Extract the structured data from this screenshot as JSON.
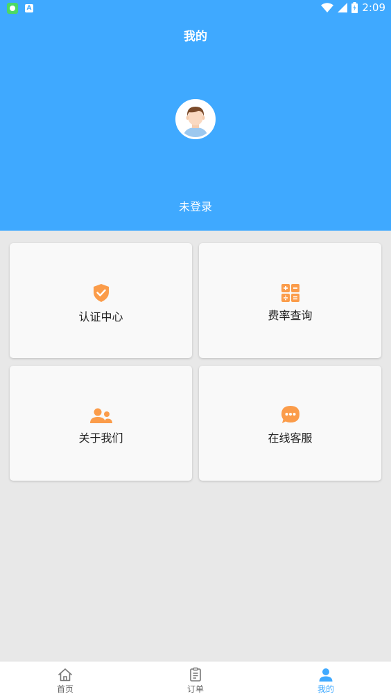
{
  "status_bar": {
    "time": "2:09"
  },
  "header": {
    "title": "我的",
    "login_status": "未登录"
  },
  "cards": [
    {
      "label": "认证中心",
      "icon": "shield-check-icon"
    },
    {
      "label": "费率查询",
      "icon": "calculator-icon"
    },
    {
      "label": "关于我们",
      "icon": "users-icon"
    },
    {
      "label": "在线客服",
      "icon": "chat-bubble-icon"
    }
  ],
  "bottom_nav": {
    "items": [
      {
        "label": "首页",
        "icon": "home-icon"
      },
      {
        "label": "订单",
        "icon": "clipboard-icon"
      },
      {
        "label": "我的",
        "icon": "user-icon",
        "active": true
      }
    ]
  },
  "colors": {
    "primary": "#3fa9ff",
    "accent": "#fb9c4a",
    "background": "#e8e8e8"
  }
}
